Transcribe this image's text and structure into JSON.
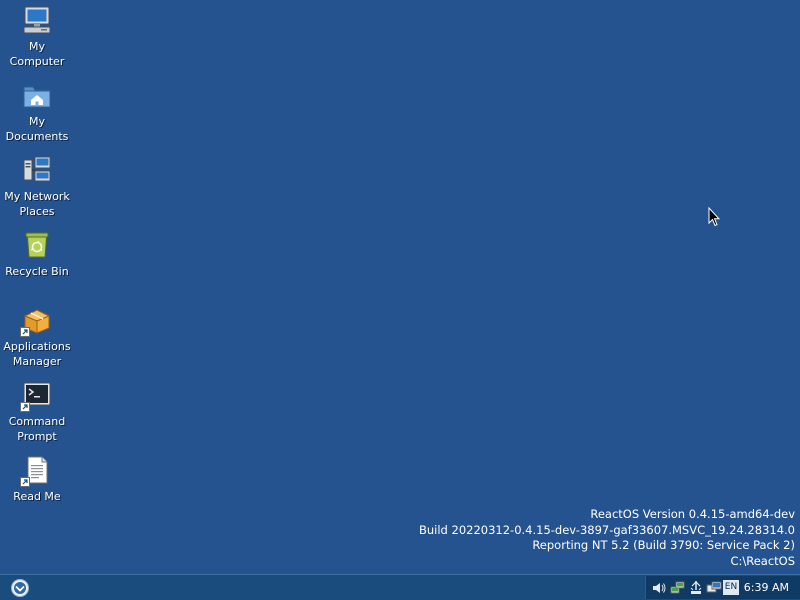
{
  "desktop": {
    "background_color": "#245390",
    "icons": [
      {
        "name": "my-computer-icon",
        "label": "My Computer"
      },
      {
        "name": "my-documents-icon",
        "label": "My Documents"
      },
      {
        "name": "my-network-places-icon",
        "label": "My Network Places"
      },
      {
        "name": "recycle-bin-icon",
        "label": "Recycle Bin"
      },
      {
        "name": "applications-manager-icon",
        "label": "Applications Manager"
      },
      {
        "name": "command-prompt-icon",
        "label": "Command Prompt"
      },
      {
        "name": "read-me-icon",
        "label": "Read Me"
      }
    ],
    "version_info": {
      "line1": "ReactOS Version 0.4.15-amd64-dev",
      "line2": "Build 20220312-0.4.15-dev-3897-gaf33607.MSVC_19.24.28314.0",
      "line3": "Reporting NT 5.2 (Build 3790: Service Pack 2)",
      "line4": "C:\\ReactOS"
    }
  },
  "taskbar": {
    "background_color": "#1a4c7d",
    "start_icon": "reactos-logo-icon",
    "tray": {
      "icons": [
        "volume-icon",
        "network-icon",
        "safely-remove-icon",
        "monitor-icon"
      ],
      "language": "EN",
      "clock": "6:39 AM"
    }
  }
}
